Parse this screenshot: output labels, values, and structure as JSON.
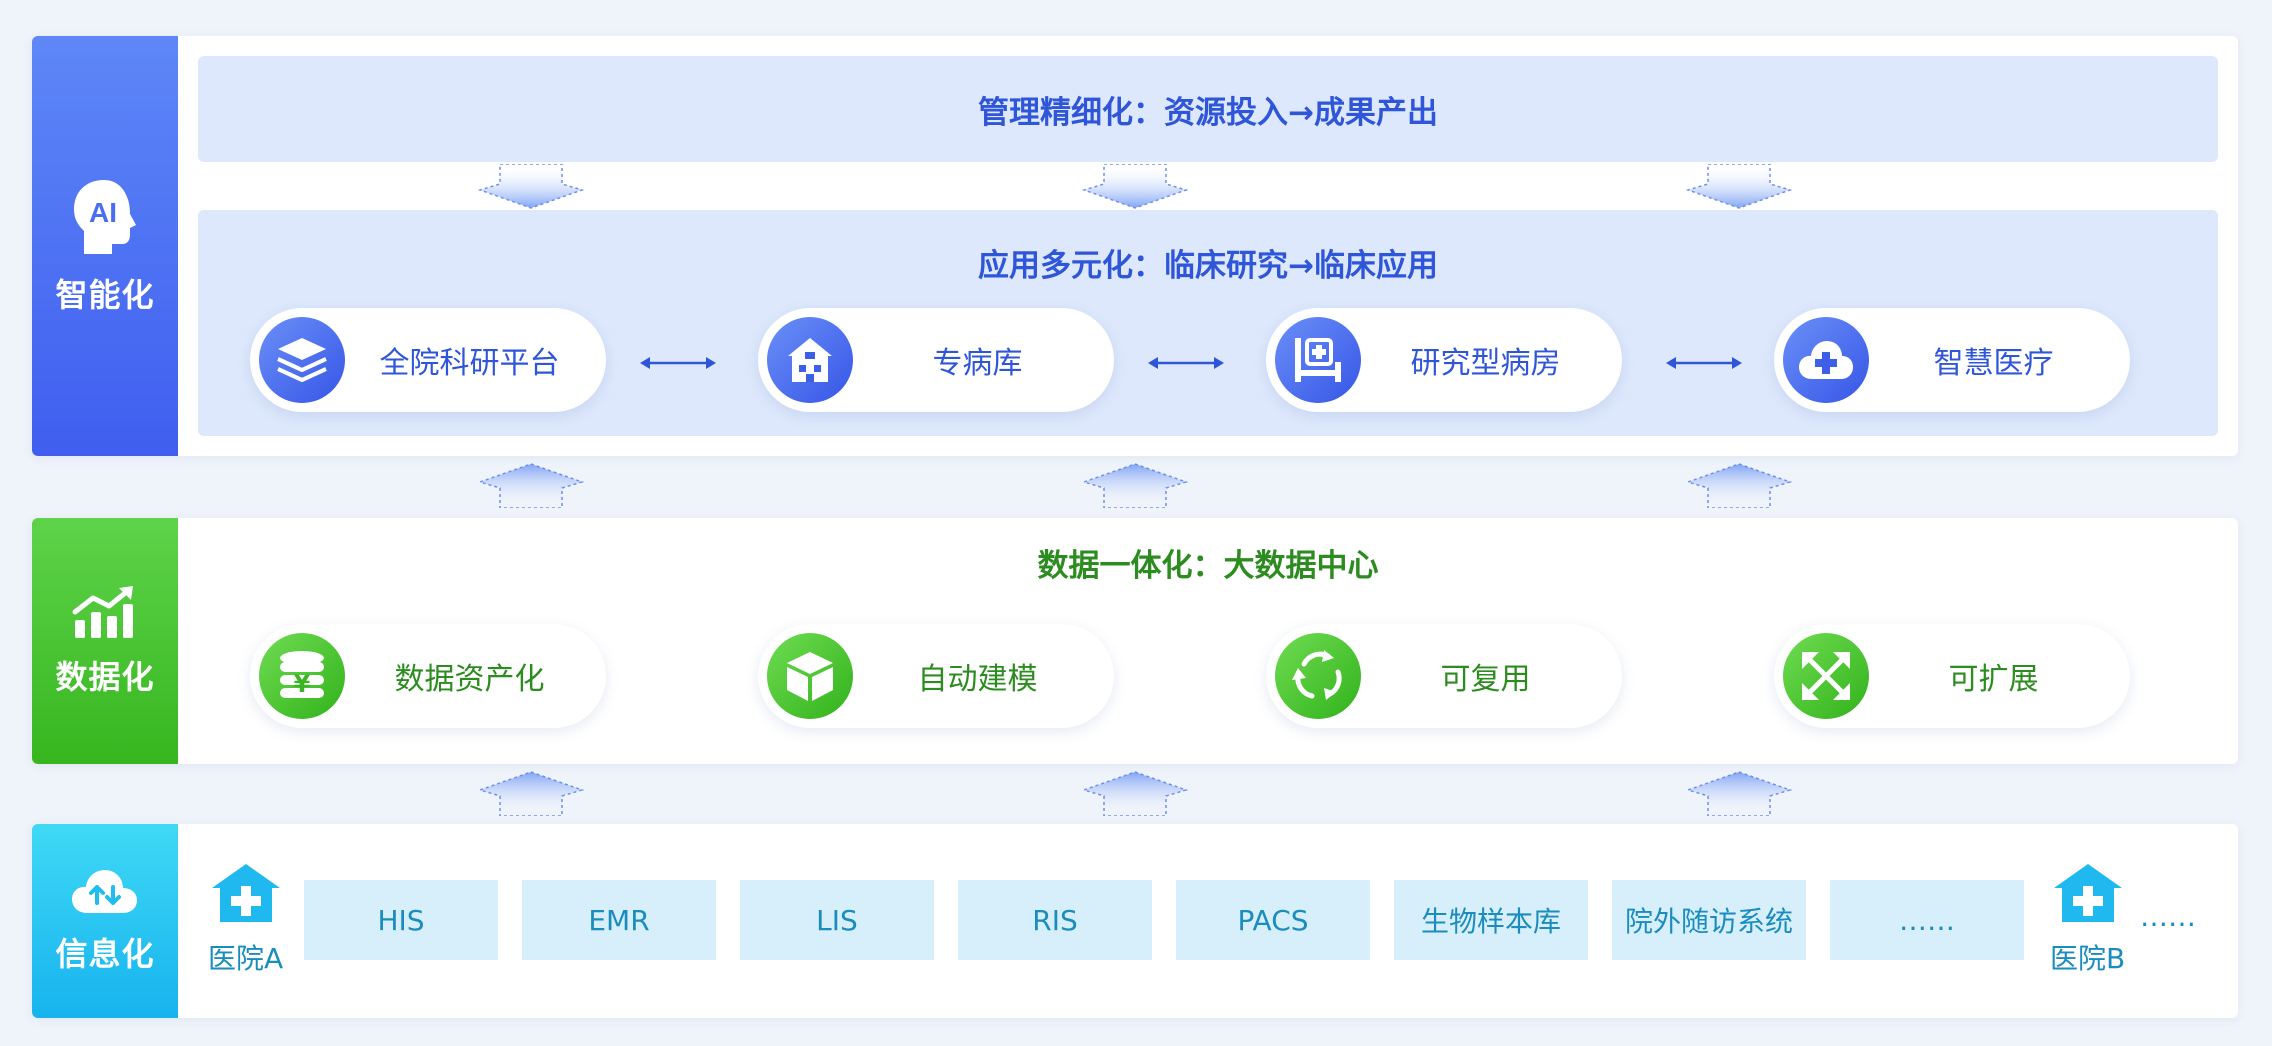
{
  "layers": {
    "ai": {
      "side_label": "智能化",
      "icon": "ai-head-icon",
      "top_banner": "管理精细化：资源投入→成果产出",
      "app_banner": "应用多元化：临床研究→临床应用",
      "items": [
        {
          "label": "全院科研平台",
          "icon": "layers-icon"
        },
        {
          "label": "专病库",
          "icon": "building-icon"
        },
        {
          "label": "研究型病房",
          "icon": "hospital-bed-icon"
        },
        {
          "label": "智慧医疗",
          "icon": "cloud-plus-icon"
        }
      ]
    },
    "data": {
      "side_label": "数据化",
      "icon": "growth-chart-icon",
      "title": "数据一体化：大数据中心",
      "items": [
        {
          "label": "数据资产化",
          "icon": "coin-database-icon"
        },
        {
          "label": "自动建模",
          "icon": "cube-icon"
        },
        {
          "label": "可复用",
          "icon": "recycle-icon"
        },
        {
          "label": "可扩展",
          "icon": "expand-icon"
        }
      ]
    },
    "info": {
      "side_label": "信息化",
      "icon": "cloud-sync-icon",
      "hospital_a": "医院A",
      "hospital_b": "医院B",
      "systems": [
        "HIS",
        "EMR",
        "LIS",
        "RIS",
        "PACS",
        "生物样本库",
        "院外随访系统",
        "……"
      ],
      "trailing": "……"
    }
  },
  "colors": {
    "ai_blue": "#3f5ef0",
    "data_green": "#37b61f",
    "info_cyan": "#17b3ee",
    "banner_bg": "#dde8fc",
    "system_bg": "#d7effa"
  }
}
